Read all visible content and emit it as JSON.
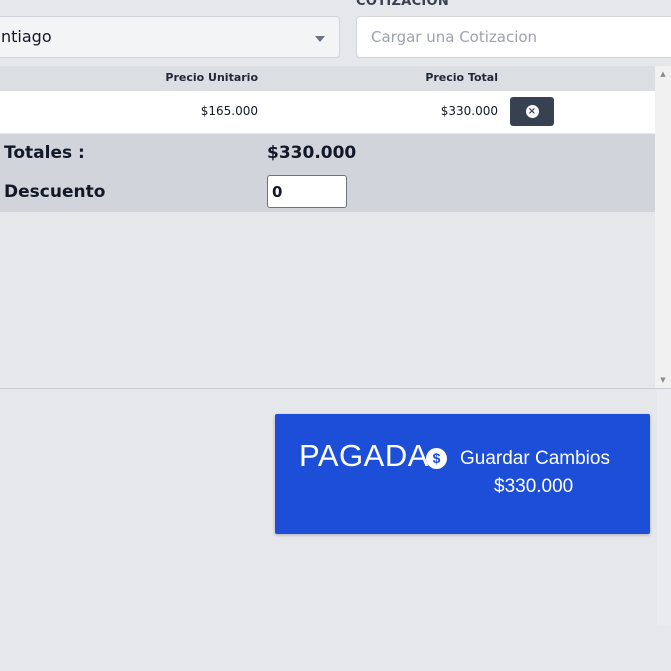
{
  "header": {
    "quote_label": "COTIZACION",
    "location_select_value": "ntiago",
    "quote_input_placeholder": "Cargar una Cotizacion"
  },
  "table": {
    "columns": [
      "Precio Unitario",
      "Precio Total"
    ],
    "rows": [
      {
        "unit_price": "$165.000",
        "total_price": "$330.000"
      }
    ]
  },
  "summary": {
    "totals_label": "Totales :",
    "totals_value": "$330.000",
    "discount_label": "Descuento",
    "discount_value": "0"
  },
  "action": {
    "status": "PAGADA",
    "save_label": "Guardar Cambios",
    "save_amount": "$330.000",
    "accent_color": "#1d4ed8"
  },
  "icons": {
    "select_caret": "chevron-down-icon",
    "remove": "x-circle-icon",
    "money": "dollar-circle-icon"
  }
}
